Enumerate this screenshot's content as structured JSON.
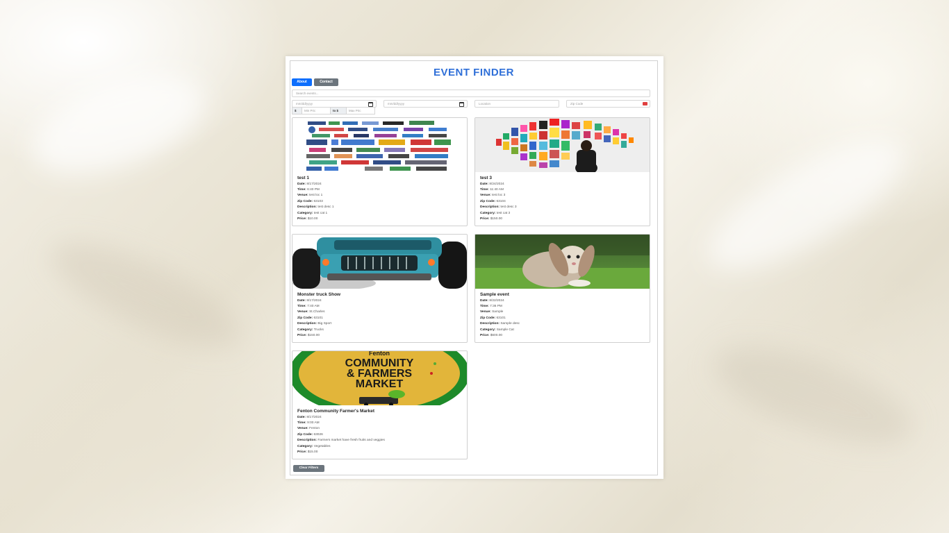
{
  "app": {
    "title": "EVENT FINDER"
  },
  "nav": {
    "about_label": "About",
    "contact_label": "Contact"
  },
  "filters": {
    "search_placeholder": "Search events...",
    "start_date_placeholder": "mm/dd/yyyy",
    "end_date_placeholder": "mm/dd/yyyy",
    "location_placeholder": "Location",
    "zip_placeholder": "Zip Code",
    "currency_symbol": "$",
    "min_price_placeholder": "Min Pric",
    "to_label": "to $",
    "max_price_placeholder": "Max Pric",
    "clear_label": "Clear Filters"
  },
  "labels": {
    "date": "Date:",
    "time": "Time:",
    "venue": "Venue:",
    "zip": "Zip Code:",
    "description": "Description:",
    "category": "Category:",
    "price": "Price:"
  },
  "events": [
    {
      "title": "test 1",
      "date": "8/17/2024",
      "time": "6:40 PM",
      "venue": "test loc 1",
      "zip": "63103",
      "description": "test desc 1",
      "category": "test cat 1",
      "price": "$10.00",
      "image": "sponsor-logos-collage"
    },
    {
      "title": "test 3",
      "date": "8/24/2024",
      "time": "11:40 AM",
      "venue": "test loc 3",
      "zip": "63104",
      "description": "test desc 3",
      "category": "test cat 3",
      "price": "$150.00",
      "image": "art-gallery-wall"
    },
    {
      "title": "Monster truck Show",
      "date": "8/17/2024",
      "time": "7:40 AM",
      "venue": "St.Charles",
      "zip": "63101",
      "description": "Big Sport",
      "category": "Trucks",
      "price": "$150.00",
      "image": "monster-truck"
    },
    {
      "title": "Sample event",
      "date": "8/22/2024",
      "time": "7:36 PM",
      "venue": "Sample",
      "zip": "63101",
      "description": "Sample desc",
      "category": "Sample Cat",
      "price": "$600.00",
      "image": "rabbit-on-grass"
    },
    {
      "title": "Fenton Community Farmer's Market",
      "date": "8/17/2024",
      "time": "9:00 AM",
      "venue": "Fenton",
      "zip": "63026",
      "description": "Farmers market have fresh fruits and veggies",
      "category": "Vegetables",
      "price": "$15.00",
      "image": "farmers-market-logo",
      "image_text": {
        "top": "Fenton",
        "line1": "COMMUNITY",
        "line2": "& FARMERS",
        "line3": "MARKET"
      }
    }
  ],
  "colors": {
    "accent": "#0d6efd",
    "title": "#2f6fd8",
    "secondary": "#6c757d"
  }
}
